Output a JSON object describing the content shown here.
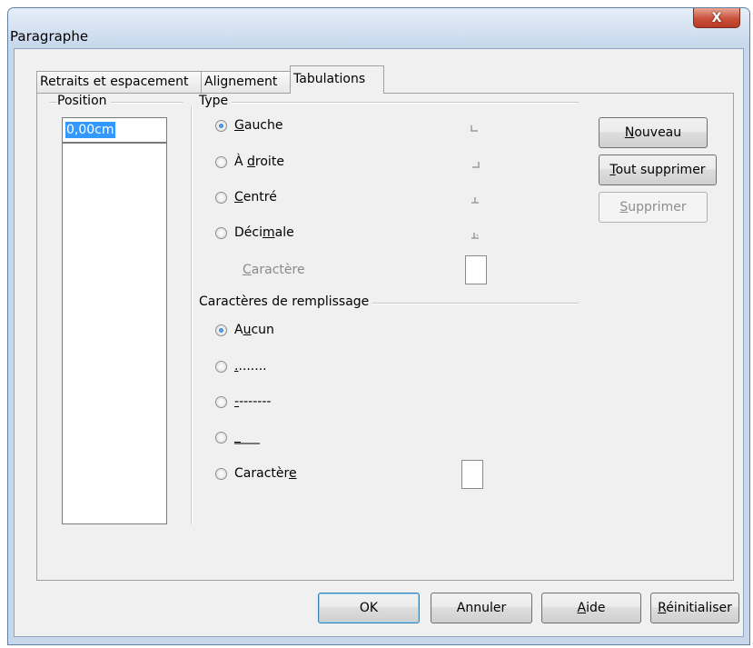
{
  "window": {
    "title": "Paragraphe",
    "close_glyph": "X"
  },
  "tabs": [
    {
      "label": "Retraits et espacement"
    },
    {
      "label": "Alignement"
    },
    {
      "label": "Tabulations"
    }
  ],
  "position": {
    "label": "Position",
    "value": "0,00cm"
  },
  "type": {
    "label": "Type",
    "options": [
      {
        "pre": "",
        "key": "G",
        "post": "auche",
        "checked": true
      },
      {
        "pre": "À ",
        "key": "d",
        "post": "roite",
        "checked": false
      },
      {
        "pre": "",
        "key": "C",
        "post": "entré",
        "checked": false
      },
      {
        "pre": "Déci",
        "key": "m",
        "post": "ale",
        "checked": false
      }
    ],
    "character_label": {
      "pre": "",
      "key": "C",
      "post": "aractère"
    }
  },
  "fill": {
    "label": "Caractères de remplissage",
    "options": [
      {
        "pre": "A",
        "key": "u",
        "post": "cun",
        "checked": true
      },
      {
        "pre": "",
        "key": ".",
        "post": ".......",
        "checked": false
      },
      {
        "pre": "",
        "key": "-",
        "post": "-------",
        "checked": false
      },
      {
        "pre": "",
        "key": "_",
        "post": "___",
        "checked": false
      },
      {
        "pre": "Caractèr",
        "key": "e",
        "post": "",
        "checked": false
      }
    ]
  },
  "side_buttons": {
    "new": {
      "key": "N",
      "post": "ouveau"
    },
    "delete_all": {
      "key": "T",
      "post": "out supprimer"
    },
    "delete": {
      "key": "S",
      "post": "upprimer"
    }
  },
  "footer": {
    "ok": "OK",
    "cancel": "Annuler",
    "help": {
      "key": "A",
      "post": "ide"
    },
    "reset": {
      "key": "R",
      "post": "éinitialiser"
    }
  }
}
